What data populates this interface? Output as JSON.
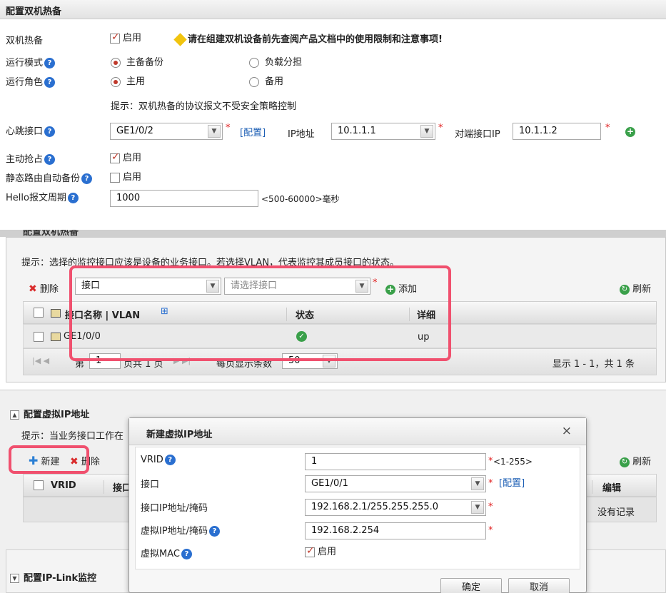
{
  "section1": {
    "title": "配置双机热备",
    "rows": {
      "hot_standby": {
        "label": "双机热备",
        "checkbox": "启用",
        "warning": "请在组建双机设备前先查阅产品文档中的使用限制和注意事项!"
      },
      "run_mode": {
        "label": "运行模式",
        "opt1": "主备备份",
        "opt2": "负载分担"
      },
      "run_role": {
        "label": "运行角色",
        "opt1": "主用",
        "opt2": "备用"
      },
      "tip": "提示：双机热备的协议报文不受安全策略控制",
      "heartbeat": {
        "label": "心跳接口",
        "value": "GE1/0/2",
        "config_link": "[配置]",
        "ip_label": "IP地址",
        "ip_value": "10.1.1.1",
        "peer_label": "对端接口IP",
        "peer_value": "10.1.1.2"
      },
      "preempt": {
        "label": "主动抢占",
        "checkbox": "启用"
      },
      "static_route": {
        "label": "静态路由自动备份",
        "checkbox": "启用"
      },
      "hello": {
        "label": "Hello报文周期",
        "value": "1000",
        "hint": "<500-60000>毫秒"
      }
    }
  },
  "monitor": {
    "partial_title": "配置双机热备",
    "tip": "提示：选择的监控接口应该是设备的业务接口。若选择VLAN，代表监控其成员接口的状态。",
    "toolbar": {
      "delete": "删除",
      "type_select": "接口",
      "iface_placeholder": "请选择接口",
      "add": "添加",
      "refresh": "刷新"
    },
    "columns": [
      "接口名称 | VLAN",
      "状态",
      "详细"
    ],
    "rows": [
      {
        "name": "GE1/0/0",
        "detail": "up"
      }
    ],
    "pager": {
      "page_prefix": "第",
      "page": "1",
      "page_suffix": "页共 1 页",
      "per_page": "每页显示条数",
      "per_page_value": "50",
      "summary": "显示 1 - 1，共 1 条"
    }
  },
  "vip": {
    "title": "配置虚拟IP地址",
    "tip": "提示：当业务接口工作在",
    "toolbar": {
      "new": "新建",
      "delete": "删除",
      "refresh": "刷新"
    },
    "columns": {
      "vrid": "VRID",
      "iface": "接口",
      "edit": "编辑"
    },
    "empty": "没有记录"
  },
  "iplink": {
    "title": "配置IP-Link监控"
  },
  "dialog": {
    "title": "新建虚拟IP地址",
    "close": "×",
    "vrid": {
      "label": "VRID",
      "value": "1",
      "hint": "<1-255>"
    },
    "iface": {
      "label": "接口",
      "value": "GE1/0/1",
      "config_link": "[配置]"
    },
    "iface_ip": {
      "label": "接口IP地址/掩码",
      "value": "192.168.2.1/255.255.255.0"
    },
    "vip": {
      "label": "虚拟IP地址/掩码",
      "value": "192.168.2.254"
    },
    "vmac": {
      "label": "虚拟MAC",
      "checkbox": "启用"
    },
    "ok": "确定",
    "cancel": "取消"
  }
}
